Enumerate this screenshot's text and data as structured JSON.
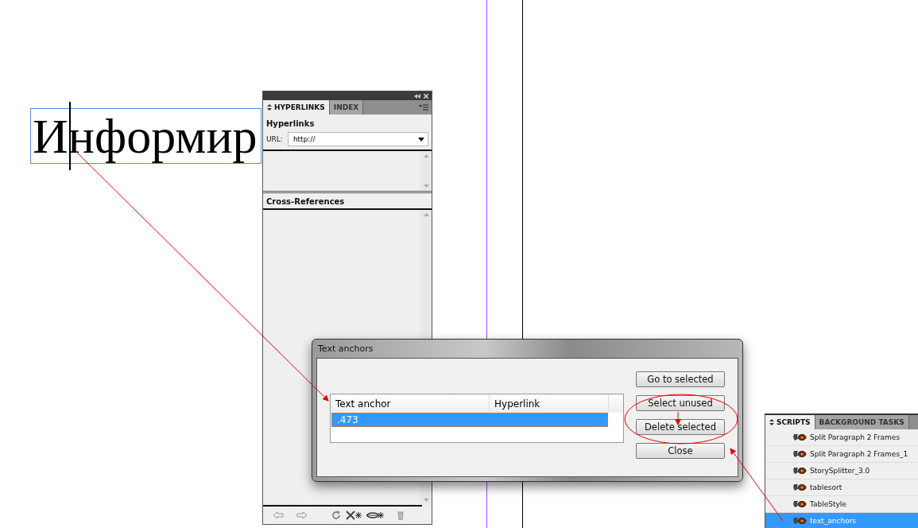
{
  "canvas": {
    "text_frame": "Информир"
  },
  "hyperlinks_panel": {
    "tabs": [
      {
        "label": "HYPERLINKS",
        "selected": true
      },
      {
        "label": "INDEX",
        "selected": false
      }
    ],
    "section_title": "Hyperlinks",
    "url_label": "URL:",
    "url_value": "http://",
    "cross_references_title": "Cross-References"
  },
  "dialog": {
    "title": "Text anchors",
    "columns": [
      "Text anchor",
      "Hyperlink"
    ],
    "rows": [
      {
        "text_anchor": ".473",
        "selected": true
      }
    ],
    "buttons": [
      "Go to selected",
      "Select unused",
      "Delete selected",
      "Close"
    ]
  },
  "scripts_panel": {
    "tabs": [
      {
        "label": "SCRIPTS",
        "selected": true
      },
      {
        "label": "BACKGROUND TASKS",
        "selected": false
      }
    ],
    "items": [
      {
        "label": "Split Paragraph 2 Frames",
        "selected": false
      },
      {
        "label": "Split Paragraph 2 Frames_1",
        "selected": false
      },
      {
        "label": "StorySplitter_3.0",
        "selected": false
      },
      {
        "label": "tablesort",
        "selected": false
      },
      {
        "label": "TableStyle",
        "selected": false
      },
      {
        "label": "text_anchors",
        "selected": true
      }
    ]
  }
}
